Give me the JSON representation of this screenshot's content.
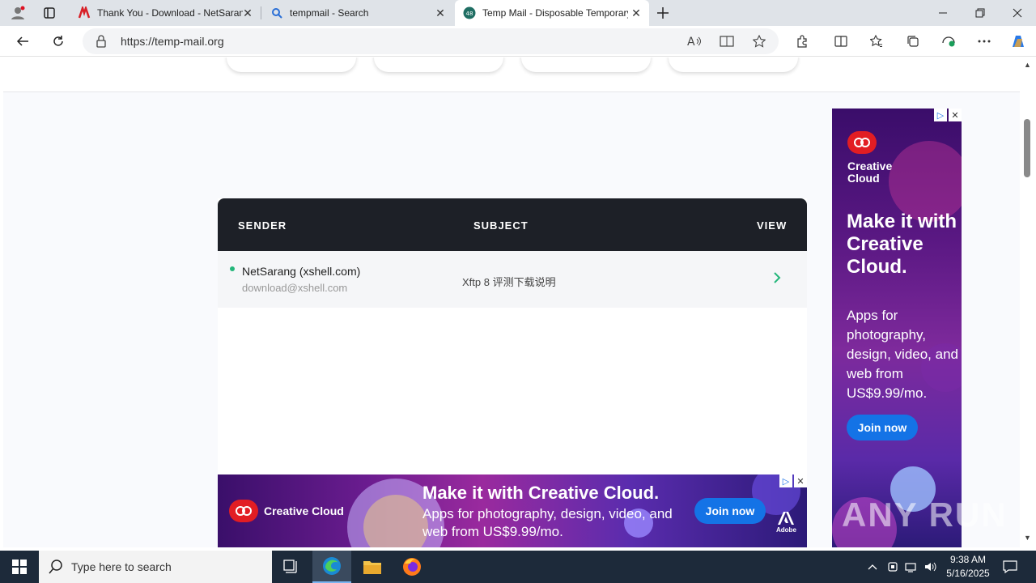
{
  "browser": {
    "tabs": [
      {
        "title": "Thank You - Download - NetSarang",
        "active": false
      },
      {
        "title": "tempmail - Search",
        "active": false
      },
      {
        "title": "Temp Mail - Disposable Temporary",
        "active": true
      }
    ],
    "url": "https://temp-mail.org"
  },
  "inbox": {
    "columns": {
      "sender": "SENDER",
      "subject": "SUBJECT",
      "view": "VIEW"
    },
    "messages": [
      {
        "sender_name": "NetSarang (xshell.com)",
        "sender_email": "download@xshell.com",
        "subject": "Xftp 8 评测下载说明"
      }
    ]
  },
  "ads": {
    "side": {
      "brand": "Creative Cloud",
      "headline": "Make it with Creative Cloud.",
      "body": "Apps for photography, design, video, and web from US$9.99/mo.",
      "cta": "Join now"
    },
    "bottom": {
      "brand": "Creative Cloud",
      "headline": "Make it with Creative Cloud.",
      "body": "Apps for photography, design, video, and web from US$9.99/mo.",
      "cta": "Join now",
      "adobe": "Adobe"
    }
  },
  "watermark": "ANY RUN",
  "taskbar": {
    "search_placeholder": "Type here to search",
    "time": "9:38 AM",
    "date": "5/16/2025"
  },
  "colors": {
    "accent_green": "#23b67a",
    "table_header": "#1d2027",
    "join_blue": "#1473e6"
  }
}
